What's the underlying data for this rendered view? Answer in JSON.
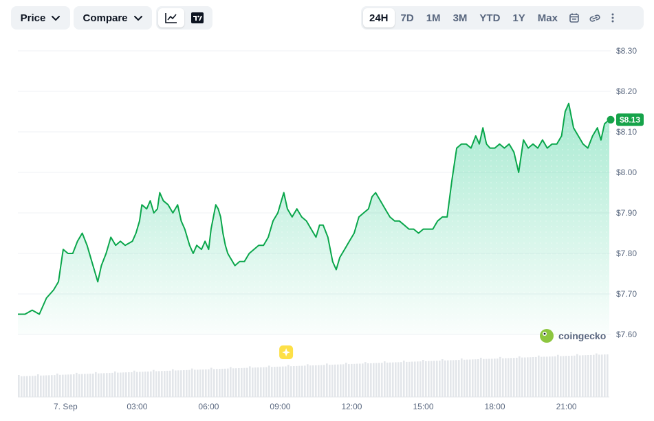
{
  "toolbar": {
    "price_label": "Price",
    "compare_label": "Compare",
    "view_options": [
      {
        "name": "line-chart-icon",
        "active": true
      },
      {
        "name": "tradingview-icon",
        "active": false
      }
    ],
    "ranges": [
      "24H",
      "7D",
      "1M",
      "3M",
      "YTD",
      "1Y",
      "Max"
    ],
    "active_range": "24H",
    "icons": [
      "calendar-icon",
      "link-icon",
      "more-icon"
    ]
  },
  "watermark": "coingecko",
  "current_price_label": "$8.13",
  "colors": {
    "line": "#16c784",
    "line_dark": "#0aa64b",
    "badge": "#16a34a",
    "volume": "#e3e6ea",
    "grid": "#eff2f5"
  },
  "chart_data": {
    "type": "area",
    "x_unit": "hours since 7 Sep 00:00 (24H view)",
    "xlim": [
      -2.0,
      22.8
    ],
    "ylim": [
      7.57,
      8.32
    ],
    "y_ticks": [
      "$8.30",
      "$8.20",
      "$8.10",
      "$8.00",
      "$7.90",
      "$7.80",
      "$7.70",
      "$7.60"
    ],
    "y_tick_values": [
      8.3,
      8.2,
      8.1,
      8.0,
      7.9,
      7.8,
      7.7,
      7.6
    ],
    "x_ticks": [
      "7. Sep",
      "03:00",
      "06:00",
      "09:00",
      "12:00",
      "15:00",
      "18:00",
      "21:00"
    ],
    "x_tick_values": [
      0,
      3,
      6,
      9,
      12,
      15,
      18,
      21
    ],
    "event_marker_x": 9.25,
    "series": [
      {
        "values": [
          [
            -2.0,
            7.65
          ],
          [
            -1.7,
            7.65
          ],
          [
            -1.4,
            7.66
          ],
          [
            -1.1,
            7.65
          ],
          [
            -0.8,
            7.69
          ],
          [
            -0.5,
            7.71
          ],
          [
            -0.3,
            7.73
          ],
          [
            -0.1,
            7.81
          ],
          [
            0.1,
            7.8
          ],
          [
            0.3,
            7.8
          ],
          [
            0.5,
            7.83
          ],
          [
            0.7,
            7.85
          ],
          [
            0.9,
            7.82
          ],
          [
            1.1,
            7.78
          ],
          [
            1.2,
            7.76
          ],
          [
            1.35,
            7.73
          ],
          [
            1.5,
            7.77
          ],
          [
            1.7,
            7.8
          ],
          [
            1.9,
            7.84
          ],
          [
            2.1,
            7.82
          ],
          [
            2.3,
            7.83
          ],
          [
            2.5,
            7.82
          ],
          [
            2.8,
            7.83
          ],
          [
            2.95,
            7.85
          ],
          [
            3.1,
            7.88
          ],
          [
            3.2,
            7.92
          ],
          [
            3.4,
            7.91
          ],
          [
            3.55,
            7.93
          ],
          [
            3.7,
            7.9
          ],
          [
            3.85,
            7.91
          ],
          [
            3.95,
            7.95
          ],
          [
            4.1,
            7.93
          ],
          [
            4.3,
            7.92
          ],
          [
            4.5,
            7.9
          ],
          [
            4.7,
            7.92
          ],
          [
            4.85,
            7.88
          ],
          [
            5.0,
            7.86
          ],
          [
            5.2,
            7.82
          ],
          [
            5.35,
            7.8
          ],
          [
            5.5,
            7.82
          ],
          [
            5.7,
            7.81
          ],
          [
            5.85,
            7.83
          ],
          [
            6.0,
            7.81
          ],
          [
            6.1,
            7.86
          ],
          [
            6.3,
            7.92
          ],
          [
            6.4,
            7.91
          ],
          [
            6.5,
            7.89
          ],
          [
            6.6,
            7.85
          ],
          [
            6.7,
            7.82
          ],
          [
            6.8,
            7.8
          ],
          [
            6.9,
            7.79
          ],
          [
            7.0,
            7.78
          ],
          [
            7.1,
            7.77
          ],
          [
            7.3,
            7.78
          ],
          [
            7.5,
            7.78
          ],
          [
            7.7,
            7.8
          ],
          [
            7.9,
            7.81
          ],
          [
            8.1,
            7.82
          ],
          [
            8.3,
            7.82
          ],
          [
            8.5,
            7.84
          ],
          [
            8.7,
            7.88
          ],
          [
            8.9,
            7.9
          ],
          [
            9.05,
            7.93
          ],
          [
            9.15,
            7.95
          ],
          [
            9.3,
            7.91
          ],
          [
            9.5,
            7.89
          ],
          [
            9.7,
            7.91
          ],
          [
            9.9,
            7.89
          ],
          [
            10.1,
            7.88
          ],
          [
            10.3,
            7.86
          ],
          [
            10.5,
            7.84
          ],
          [
            10.65,
            7.87
          ],
          [
            10.8,
            7.87
          ],
          [
            11.0,
            7.84
          ],
          [
            11.2,
            7.78
          ],
          [
            11.35,
            7.76
          ],
          [
            11.5,
            7.79
          ],
          [
            11.7,
            7.81
          ],
          [
            11.9,
            7.83
          ],
          [
            12.1,
            7.85
          ],
          [
            12.3,
            7.89
          ],
          [
            12.5,
            7.9
          ],
          [
            12.7,
            7.91
          ],
          [
            12.85,
            7.94
          ],
          [
            13.0,
            7.95
          ],
          [
            13.2,
            7.93
          ],
          [
            13.4,
            7.91
          ],
          [
            13.6,
            7.89
          ],
          [
            13.8,
            7.88
          ],
          [
            14.0,
            7.88
          ],
          [
            14.2,
            7.87
          ],
          [
            14.4,
            7.86
          ],
          [
            14.6,
            7.86
          ],
          [
            14.8,
            7.85
          ],
          [
            15.0,
            7.86
          ],
          [
            15.2,
            7.86
          ],
          [
            15.4,
            7.86
          ],
          [
            15.6,
            7.88
          ],
          [
            15.8,
            7.89
          ],
          [
            16.0,
            7.89
          ],
          [
            16.2,
            7.98
          ],
          [
            16.4,
            8.06
          ],
          [
            16.6,
            8.07
          ],
          [
            16.8,
            8.07
          ],
          [
            17.0,
            8.06
          ],
          [
            17.2,
            8.09
          ],
          [
            17.35,
            8.07
          ],
          [
            17.5,
            8.11
          ],
          [
            17.65,
            8.07
          ],
          [
            17.8,
            8.06
          ],
          [
            18.0,
            8.06
          ],
          [
            18.2,
            8.07
          ],
          [
            18.4,
            8.06
          ],
          [
            18.6,
            8.07
          ],
          [
            18.8,
            8.05
          ],
          [
            19.0,
            8.0
          ],
          [
            19.2,
            8.08
          ],
          [
            19.4,
            8.06
          ],
          [
            19.6,
            8.07
          ],
          [
            19.8,
            8.06
          ],
          [
            20.0,
            8.08
          ],
          [
            20.2,
            8.06
          ],
          [
            20.4,
            8.07
          ],
          [
            20.6,
            8.07
          ],
          [
            20.8,
            8.09
          ],
          [
            20.95,
            8.15
          ],
          [
            21.1,
            8.17
          ],
          [
            21.3,
            8.11
          ],
          [
            21.5,
            8.09
          ],
          [
            21.7,
            8.07
          ],
          [
            21.9,
            8.06
          ],
          [
            22.1,
            8.09
          ],
          [
            22.3,
            8.11
          ],
          [
            22.45,
            8.08
          ],
          [
            22.6,
            8.12
          ],
          [
            22.8,
            8.13
          ]
        ]
      }
    ],
    "current_price": 8.13
  }
}
